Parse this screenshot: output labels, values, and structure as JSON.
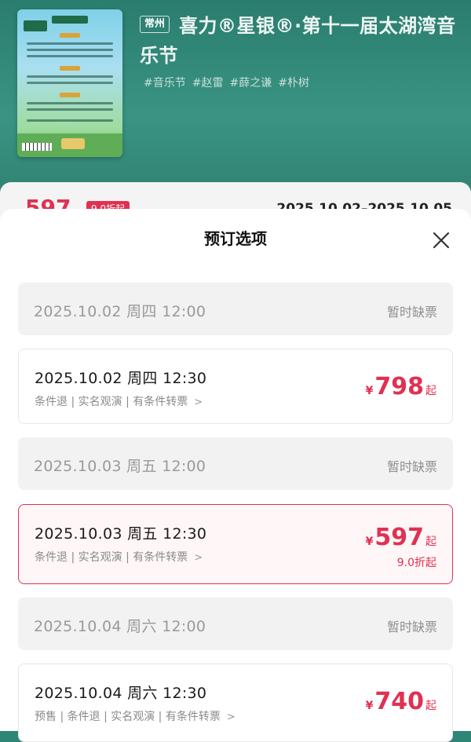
{
  "event": {
    "city": "常州",
    "title": "喜力®星银®·第十一届太湖湾音乐节",
    "hashtags": [
      "#音乐节",
      "#赵雷",
      "#薛之谦",
      "#朴树"
    ]
  },
  "peek": {
    "price": "597",
    "discount": "9.0折起",
    "date_range": "2025.10.02–2025.10.05"
  },
  "sheet": {
    "title": "预订选项",
    "options": [
      {
        "datetime": "2025.10.02 周四 12:00",
        "status": "暂时缺票"
      },
      {
        "datetime": "2025.10.02 周四 12:30",
        "rules": "条件退 | 实名观演 | 有条件转票",
        "currency": "¥",
        "price": "798",
        "suffix": "起"
      },
      {
        "datetime": "2025.10.03 周五 12:00",
        "status": "暂时缺票"
      },
      {
        "datetime": "2025.10.03 周五 12:30",
        "rules": "条件退 | 实名观演 | 有条件转票",
        "currency": "¥",
        "price": "597",
        "suffix": "起",
        "discount": "9.0折起",
        "selected": true
      },
      {
        "datetime": "2025.10.04 周六 12:00",
        "status": "暂时缺票"
      },
      {
        "datetime": "2025.10.04 周六 12:30",
        "rules": "预售 | 条件退 | 实名观演 | 有条件转票",
        "currency": "¥",
        "price": "740",
        "suffix": "起"
      }
    ]
  },
  "colors": {
    "accent": "#e03152",
    "hero": "#2e8676"
  },
  "icons": {
    "close": "close-icon",
    "chevron": "chevron-right-icon"
  }
}
